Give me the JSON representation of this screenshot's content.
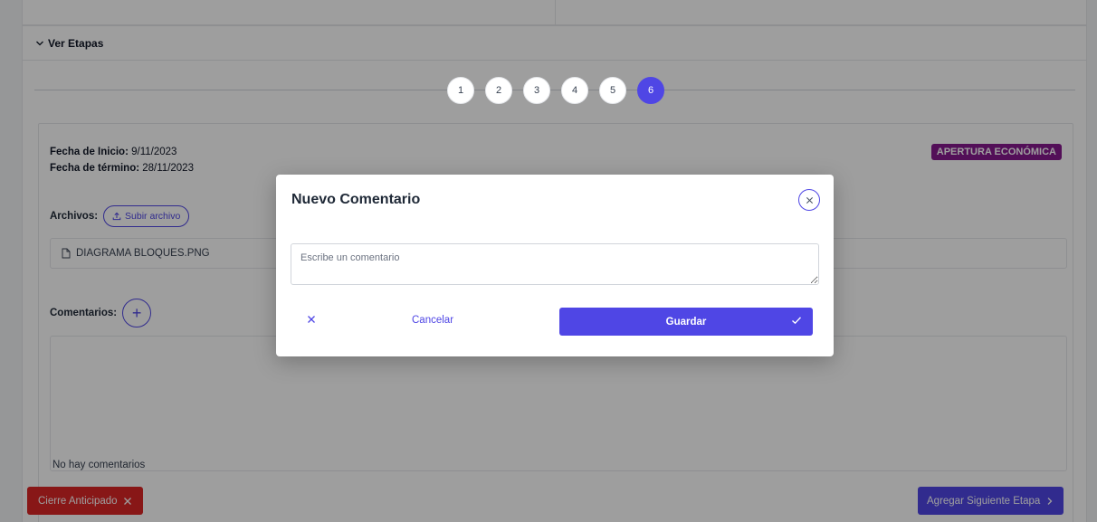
{
  "section": {
    "toggle_label": "Ver Etapas"
  },
  "stepper": {
    "steps": [
      "1",
      "2",
      "3",
      "4",
      "5",
      "6"
    ],
    "active_step": "6"
  },
  "stage": {
    "start_label": "Fecha de Inicio:",
    "start_value": "9/11/2023",
    "end_label": "Fecha de término:",
    "end_value": "28/11/2023",
    "badge": "APERTURA ECONÓMICA",
    "badge_color": "#86198f",
    "files_label": "Archivos:",
    "upload_button": "Subir archivo",
    "file_name": "DIAGRAMA BLOQUES.PNG",
    "comments_label": "Comentarios:",
    "empty_comments": "No hay comentarios"
  },
  "footer": {
    "early_close_button": "Cierre Anticipado",
    "next_stage_button": "Agregar Siguiente Etapa"
  },
  "modal": {
    "title": "Nuevo Comentario",
    "textarea_placeholder": "Escribe un comentario",
    "cancel_label": "Cancelar",
    "save_label": "Guardar"
  },
  "colors": {
    "accent": "#4f46e5",
    "danger": "#dc2626"
  }
}
